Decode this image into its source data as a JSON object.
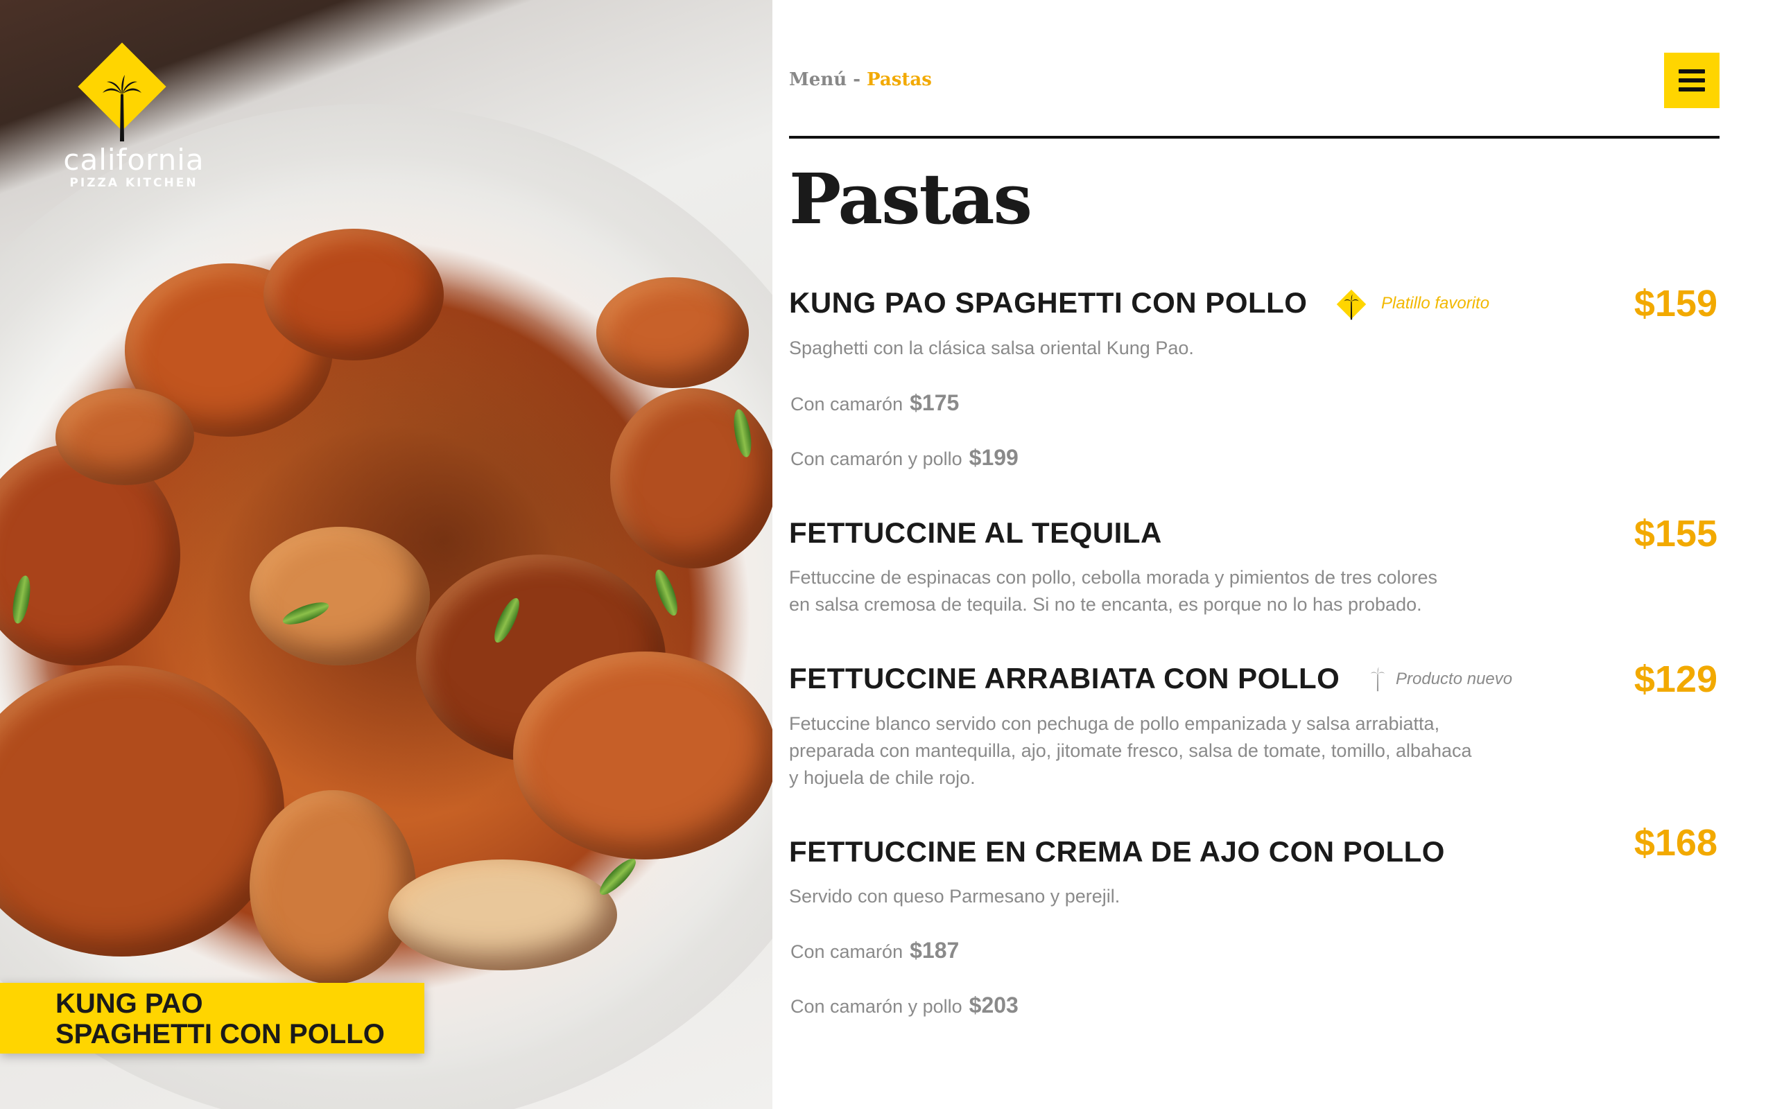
{
  "brand": {
    "name": "california",
    "subname": "PIZZA KITCHEN",
    "accent_color": "#ffd500",
    "price_color": "#f2a900"
  },
  "hero": {
    "caption_line1": "KUNG PAO",
    "caption_line2": "SPAGHETTI CON POLLO"
  },
  "breadcrumb": {
    "root": "Menú",
    "separator": "-",
    "current": "Pastas"
  },
  "menu_button": {
    "icon": "hamburger-icon"
  },
  "page_title": "Pastas",
  "items": [
    {
      "name": "KUNG PAO SPAGHETTI CON POLLO",
      "tag": "Platillo favorito",
      "tag_icon": "palm-diamond-icon",
      "price": "$159",
      "description": "Spaghetti con la clásica salsa oriental Kung Pao.",
      "variants": [
        {
          "label": "Con camarón",
          "price": "$175"
        },
        {
          "label": "Con camarón y pollo",
          "price": "$199"
        }
      ]
    },
    {
      "name": "FETTUCCINE AL TEQUILA",
      "price": "$155",
      "description_line1": "Fettuccine de espinacas con pollo, cebolla morada y pimientos de tres colores",
      "description_line2": "en salsa cremosa de tequila. Si no te encanta, es porque no lo has probado."
    },
    {
      "name": "FETTUCCINE ARRABIATA CON POLLO",
      "tag": "Producto nuevo",
      "tag_icon": "palm-icon",
      "price": "$129",
      "description_line1": "Fetuccine blanco servido con pechuga de pollo empanizada y salsa arrabiatta,",
      "description_line2": "preparada con mantequilla, ajo, jitomate fresco, salsa de tomate, tomillo, albahaca",
      "description_line3": "y hojuela de chile rojo."
    },
    {
      "name": "FETTUCCINE EN CREMA DE AJO CON POLLO",
      "price": "$168",
      "description": "Servido con queso Parmesano y perejil.",
      "variants": [
        {
          "label": "Con camarón",
          "price": "$187"
        },
        {
          "label": "Con camarón y pollo",
          "price": "$203"
        }
      ]
    }
  ]
}
